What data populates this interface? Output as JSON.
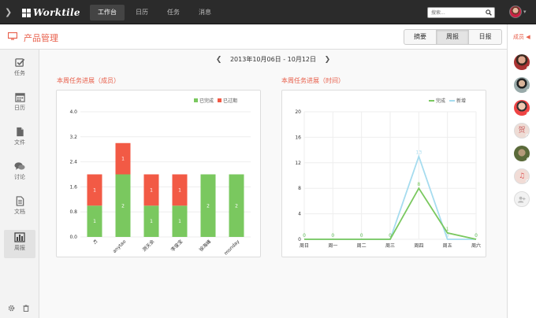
{
  "app": {
    "name": "Worktile"
  },
  "nav": {
    "items": [
      {
        "label": "工作台",
        "active": true
      },
      {
        "label": "日历",
        "active": false
      },
      {
        "label": "任务",
        "active": false
      },
      {
        "label": "消息",
        "active": false
      }
    ]
  },
  "search": {
    "placeholder": "搜索..."
  },
  "page": {
    "title": "产品管理"
  },
  "view_tabs": [
    {
      "label": "摘要",
      "active": false
    },
    {
      "label": "周报",
      "active": true
    },
    {
      "label": "日报",
      "active": false
    }
  ],
  "sidebar": {
    "items": [
      {
        "label": "任务",
        "icon": "checkbox-icon",
        "active": false
      },
      {
        "label": "日历",
        "icon": "calendar-icon",
        "active": false
      },
      {
        "label": "文件",
        "icon": "file-icon",
        "active": false
      },
      {
        "label": "讨论",
        "icon": "discussion-icon",
        "active": false
      },
      {
        "label": "文档",
        "icon": "document-icon",
        "active": false
      },
      {
        "label": "周报",
        "icon": "chart-icon",
        "active": true
      }
    ]
  },
  "members": {
    "label": "成员",
    "avatars": [
      {
        "icon": "photo",
        "status": "#4bbf4b"
      },
      {
        "icon": "photo",
        "status": "#4bbf4b"
      },
      {
        "icon": "photo",
        "status": "#4bbf4b"
      },
      {
        "icon": "贺",
        "status": "#bbbbbb"
      },
      {
        "icon": "photo",
        "status": "#4bbf4b"
      },
      {
        "icon": "music",
        "status": "#bbbbbb"
      },
      {
        "icon": "add-user",
        "status": null
      }
    ]
  },
  "week": {
    "range": "2013年10月06日 - 10月12日"
  },
  "colors": {
    "accent": "#e8604c",
    "done": "#7ac85f",
    "overdue": "#f25a45",
    "new": "#a6dcef"
  },
  "chart_data": [
    {
      "type": "bar",
      "title": "本周任务进展（成员）",
      "categories": [
        "♬",
        "anytao",
        "测天余",
        "李俊宝",
        "徐海峰",
        "monday"
      ],
      "series": [
        {
          "name": "已完成",
          "values": [
            1,
            2,
            1,
            1,
            2,
            2
          ]
        },
        {
          "name": "已过期",
          "values": [
            1,
            1,
            1,
            1,
            0,
            0
          ]
        }
      ],
      "ylim": [
        0,
        4.0
      ],
      "yticks": [
        "0.0",
        "0.8",
        "1.6",
        "2.4",
        "3.2",
        "4.0"
      ],
      "stacked": true,
      "legend": "top-right"
    },
    {
      "type": "line",
      "title": "本周任务进展（时间）",
      "x": [
        "周日",
        "周一",
        "周二",
        "周三",
        "周四",
        "周五",
        "周六"
      ],
      "series": [
        {
          "name": "完成",
          "values": [
            0,
            0,
            0,
            0,
            8,
            1,
            0
          ]
        },
        {
          "name": "新增",
          "values": [
            0,
            0,
            0,
            0,
            13,
            0,
            0
          ]
        }
      ],
      "ylim": [
        0,
        20
      ],
      "yticks": [
        "0",
        "4",
        "8",
        "12",
        "16",
        "20"
      ],
      "legend": "top-right"
    }
  ]
}
